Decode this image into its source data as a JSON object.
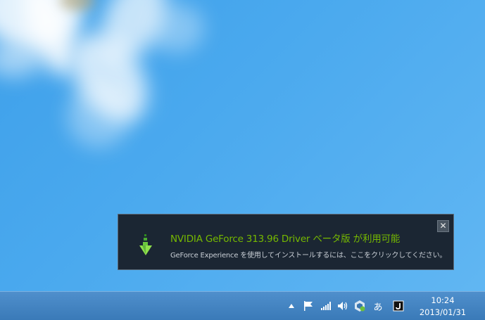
{
  "notification": {
    "title": "NVIDIA GeForce 313.96 Driver ベータ版 が利用可能",
    "message": "GeForce Experience を使用してインストールするには、ここをクリックしてください。",
    "icon": "download-arrow-icon",
    "close_label": "✕",
    "accent_color": "#76b900"
  },
  "taskbar": {
    "tray_icons": [
      "show-hidden-icons-arrow",
      "action-center-flag-icon",
      "network-signal-icon",
      "volume-icon",
      "app-tray-icon",
      "ime-mode-indicator",
      "ime-tray-icon"
    ],
    "ime_label": "あ",
    "clock": {
      "time": "10:24",
      "date": "2013/01/31"
    }
  }
}
